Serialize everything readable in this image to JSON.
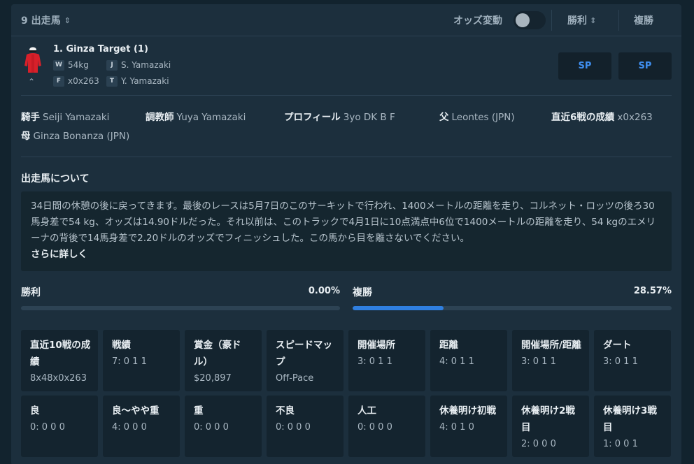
{
  "header": {
    "runners_label": "9 出走馬",
    "odds_change_label": "オッズ変動",
    "win_label": "勝利",
    "place_label": "複勝"
  },
  "runner": {
    "name": "1. Ginza Target (1)",
    "weight_badge": "W",
    "weight": "54kg",
    "jockey_badge": "J",
    "jockey": "S. Yamazaki",
    "form_badge": "F",
    "form": "x0x263",
    "trainer_badge": "T",
    "trainer": "Y. Yamazaki",
    "win_odds": "SP",
    "place_odds": "SP"
  },
  "info": {
    "jockey_label": "騎手",
    "jockey_value": "Seiji Yamazaki",
    "trainer_label": "調教師",
    "trainer_value": "Yuya Yamazaki",
    "profile_label": "プロフィール",
    "profile_value": "3yo DK B F",
    "sire_label": "父",
    "sire_value": "Leontes (JPN)",
    "last6_label": "直近6戦の成績",
    "last6_value": "x0x263",
    "dam_label": "母",
    "dam_value": "Ginza Bonanza (JPN)"
  },
  "about": {
    "title": "出走馬について",
    "text": "34日間の休憩の後に戻ってきます。最後のレースは5月7日のこのサーキットで行われ、1400メートルの距離を走り、コルネット・ロッツの後ろ30馬身差で54 kg、オッズは14.90ドルだった。それ以前は、このトラックで4月1日に10点満点中6位で1400メートルの距離を走り、54 kgのエメリーナの背後で14馬身差で2.20ドルのオッズでフィニッシュした。この馬から目を離さないでください。",
    "more_label": "さらに詳しく"
  },
  "stats": {
    "win_label": "勝利",
    "win_value": "0.00%",
    "win_fraction": 0.0,
    "place_label": "複勝",
    "place_value": "28.57%",
    "place_fraction": 0.2857
  },
  "grid": [
    {
      "label": "直近10戦の成績",
      "value": "8x48x0x263"
    },
    {
      "label": "戦績",
      "value": "7: 0 1 1"
    },
    {
      "label": "賞金（豪ドル）",
      "value": "$20,897"
    },
    {
      "label": "スピードマップ",
      "value": "Off-Pace"
    },
    {
      "label": "開催場所",
      "value": "3: 0 1 1"
    },
    {
      "label": "距離",
      "value": "4: 0 1 1"
    },
    {
      "label": "開催場所/距離",
      "value": "3: 0 1 1"
    },
    {
      "label": "ダート",
      "value": "3: 0 1 1"
    },
    {
      "label": "良",
      "value": "0: 0 0 0"
    },
    {
      "label": "良〜やや重",
      "value": "4: 0 0 0"
    },
    {
      "label": "重",
      "value": "0: 0 0 0"
    },
    {
      "label": "不良",
      "value": "0: 0 0 0"
    },
    {
      "label": "人工",
      "value": "0: 0 0 0"
    },
    {
      "label": "休養明け初戦",
      "value": "4: 0 1 0"
    },
    {
      "label": "休養明け2戦目",
      "value": "2: 0 0 0"
    },
    {
      "label": "休養明け3戦目",
      "value": "1: 0 0 1"
    }
  ],
  "icons": {
    "sort": "sort-updown-icon",
    "chevron_up": "chevron-up-icon",
    "silk": "jockey-silk-icon"
  },
  "colors": {
    "accent": "#2f7fe0",
    "silk_red": "#d8202a"
  }
}
